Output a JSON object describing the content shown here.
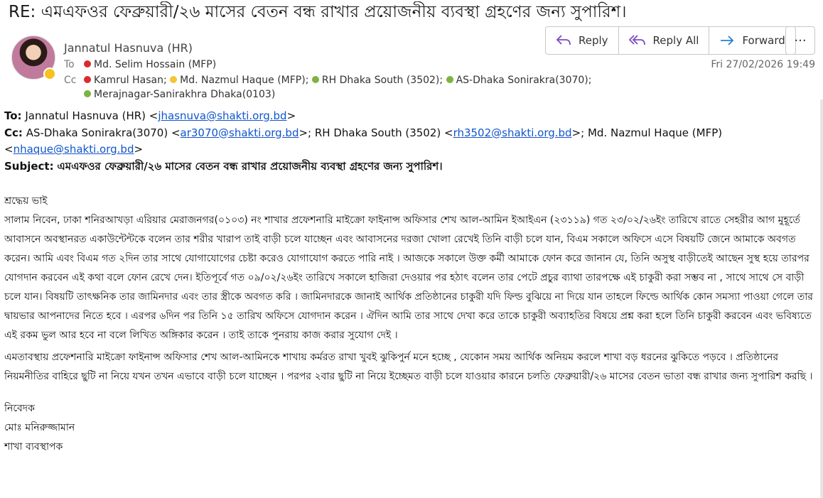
{
  "email": {
    "subject": "RE: এমএফওর ফেব্রুয়ারী/২৬ মাসের বেতন বন্ধ রাখার প্রয়োজনীয় ব্যবস্থা গ্রহণের জন্য সুপারিশ।",
    "sender": "Jannatul Hasnuva (HR)",
    "to_label": "To",
    "cc_label": "Cc",
    "to": [
      "Md. Selim Hossain (MFP)"
    ],
    "cc_line1": [
      "Kamrul Hasan;",
      "Md. Nazmul Haque (MFP);",
      "RH Dhaka South (3502);",
      "AS-Dhaka Sonirakra(3070);"
    ],
    "cc_line2": [
      "Merajnagar-Sanirakhra Dhaka(0103)"
    ],
    "timestamp": "Fri 27/02/2026 19:49"
  },
  "toolbar": {
    "reply": "Reply",
    "reply_all": "Reply All",
    "forward": "Forward",
    "more": "···"
  },
  "quoted_header": {
    "to_label": "To:",
    "to_name": "Jannatul Hasnuva (HR) <",
    "to_email": "jhasnuva@shakti.org.bd",
    "cc_label": "Cc:",
    "cc_part1": "AS-Dhaka Sonirakra(3070) <",
    "cc_email1": "ar3070@shakti.org.bd",
    "cc_part2": ">; RH Dhaka South (3502) <",
    "cc_email2": "rh3502@shakti.org.bd",
    "cc_part3": ">; Md. Nazmul Haque (MFP)",
    "cc_email3": "nhaque@shakti.org.bd",
    "subject_label": "Subject:",
    "subject": "এমএফওর ফেব্রুয়ারী/২৬ মাসের বেতন বন্ধ রাখার প্রয়োজনীয় ব্যবস্থা গ্রহণের জন্য সুপারিশ।"
  },
  "body": {
    "greeting": "শ্রদ্ধেয় ভাই",
    "para1": "সালাম নিবেন, ঢাকা শনিরআখড়া এরিয়ার মেরাজনগর(০১০৩) নং শাখার প্রফেশনারি মাইক্রো ফাইনান্স অফিসার শেখ আল-আমিন ইআইএন (২৩১১৯) গত ২৩/০২/২৬ইং তারিখে রাতে সেহরীর আগ মুহূর্তে আবাসনে অবস্থানরত একাউন্টেন্টকে বলেন তার শরীর খারাপ তাই বাড়ী চলে যাচ্ছেন এবং আবাসনের দরজা খোলা রেখেই তিনি বাড়ী চলে যান, বিএম সকালে অফিসে এসে বিষয়টি জেনে আমাকে অবগত করেন। আমি এবং বিএম গত ২দিন তার সাথে যোগাযোগের চেষ্টা করেও যোগাযোগ করতে পারি নাই । আজকে সকালে উক্ত কর্মী আমাকে ফোন করে জানান যে, তিনি অসুস্থ বাড়ীতেই আছেন সুস্থ হয়ে তারপর যোগদান করবেন এই কথা বলে ফোন রেখে দেন। ইতিপূর্বে গত ০৯/০২/২৬ইং তারিখে সকালে হাজিরা দেওয়ার পর হঠাৎ বলেন তার পেটে প্রচুর ব্যাথা তারপক্ষে এই চাকুরী করা সম্ভব না , সাথে সাথে সে বাড়ী চলে যান। বিষয়টি তাৎক্ষনিক তার জামিনদার এবং তার স্ত্রীকে অবগত করি । জামিনদারকে জানাই আর্থিক প্রতিষ্ঠানের চাকুরী যদি ফিল্ড বুঝিয়ে না দিয়ে যান তাহলে ফিল্ডে আর্থিক কোন সমস্যা পাওয়া গেলে তার দ্বায়ভার আপনাদের নিতে হবে । এরপর ৬দিন পর তিনি ১৫ তারিখ অফিসে যোগদান করেন । ঐদিন আমি তার সাথে দেখা করে তাকে চাকুরী অব্যাহতির বিষয়ে প্রশ্ন করা হলে তিনি চাকুরী করবেন এবং ভবিষ্যতে এই রকম ভুল আর হবে না বলে লিখিত অঙ্গিকার করেন । তাই তাকে পুনরায় কাজ করার সুযোগ দেই ।",
    "para2": "এমতাবস্থায় প্রফেশনারি মাইক্রো ফাইনান্স অফিসার শেখ আল-আমিনকে শাখায় কর্মরত রাখা খুবই ঝুকিপুর্ন মনে হচ্ছে , যেকোন সময় আর্থিক অনিয়ম করলে শাখা বড় ধরনের ঝুকিতে পড়বে । প্রতিষ্ঠানের নিয়মনীতির বাহিরে ছুটি না নিয়ে যখন তখন এভাবে বাড়ী চলে যাচ্ছেন । পরপর ২বার ছুটি না নিয়ে ইচ্ছেমত বাড়ী চলে যাওয়ার কারনে চলতি ফেব্রুয়ারী/২৬ মাসের বেতন ভাতা বন্ধ রাখার জন্য সুপারিশ করছি ।",
    "closing": "নিবেদক",
    "signature_name": "মোঃ মনিরুজ্জামান",
    "signature_title": "শাখা ব্যবস্থাপক"
  }
}
